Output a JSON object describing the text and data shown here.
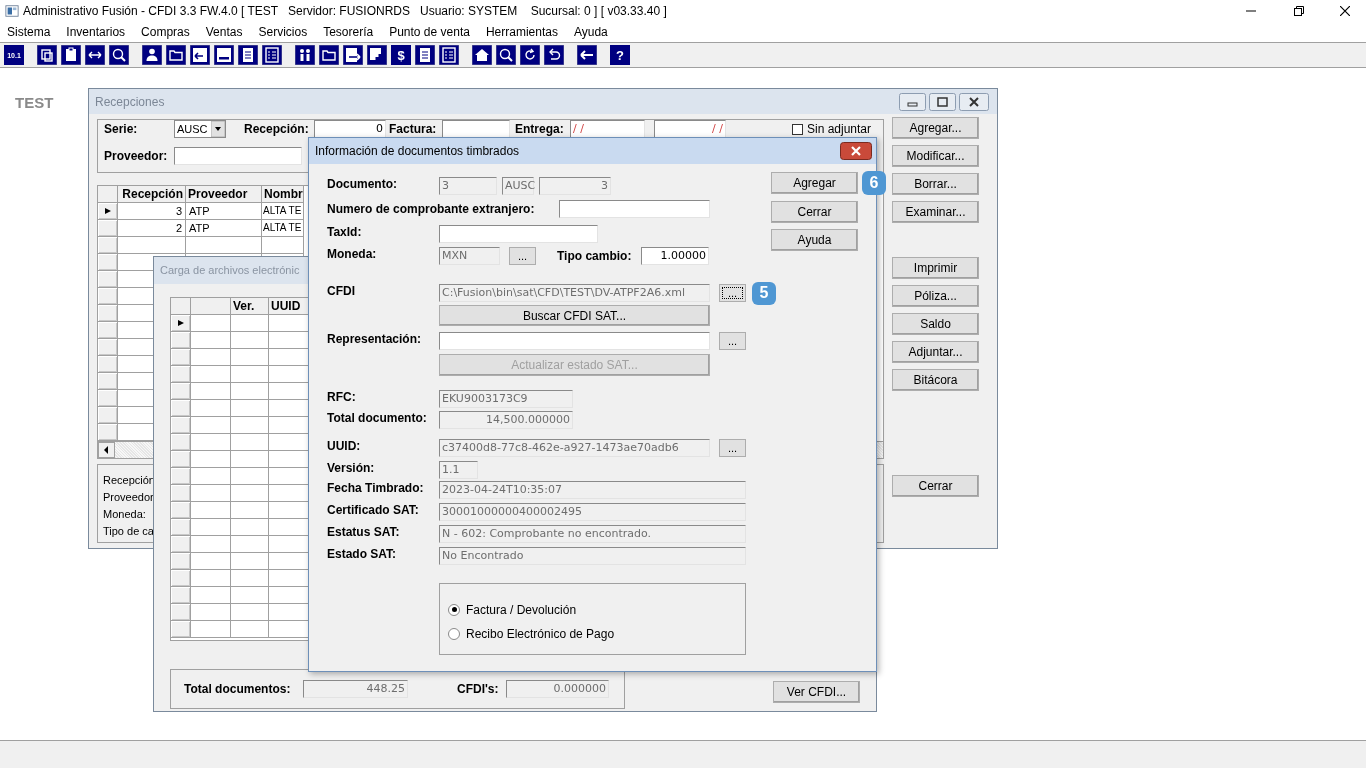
{
  "app": {
    "title": "Administrativo Fusión - CFDI 3.3 FW.4.0 [ TEST   Servidor: FUSIONRDS   Usuario: SYSTEM    Sucursal: 0 ] [ v03.33.40 ]"
  },
  "menu": [
    "Sistema",
    "Inventarios",
    "Compras",
    "Ventas",
    "Servicios",
    "Tesorería",
    "Punto de venta",
    "Herramientas",
    "Ayuda"
  ],
  "toolbar": {
    "version_glyph": "10.1",
    "dollar_glyph": "$",
    "help_glyph": "?"
  },
  "desktop_label": "TEST",
  "recepciones": {
    "title": "Recepciones",
    "serie": {
      "label": "Serie:",
      "value": "AUSC"
    },
    "recepcion": {
      "label": "Recepción:",
      "value": "0"
    },
    "factura": {
      "label": "Factura:"
    },
    "entrega": {
      "label": "Entrega:",
      "from": "/ /",
      "to": "/ /"
    },
    "sin_adjuntar": {
      "label": "Sin adjuntar",
      "checked": false
    },
    "proveedor": {
      "label": "Proveedor:"
    },
    "table": {
      "columns": [
        "Recepción",
        "Proveedor",
        "Nombr"
      ],
      "rows": [
        {
          "cells": [
            "3",
            "ATP",
            "ALTA TE"
          ],
          "selected": true
        },
        {
          "cells": [
            "2",
            "ATP",
            "ALTA TE"
          ],
          "selected": false
        }
      ]
    },
    "info_labels": [
      "Recepción",
      "Proveedor",
      "Moneda:",
      "Tipo de ca"
    ],
    "button_groups": [
      [
        "Agregar...",
        "Modificar...",
        "Borrar...",
        "Examinar..."
      ],
      [
        "Imprimir",
        "Póliza...",
        "Saldo",
        "Adjuntar...",
        "Bitácora"
      ],
      [
        "Cerrar"
      ]
    ]
  },
  "carga": {
    "title": "Carga de archivos electrónic",
    "columns": [
      "Ver.",
      "UUID"
    ],
    "total_documentos": {
      "label": "Total documentos:",
      "value": "448.25"
    },
    "cfdis": {
      "label": "CFDI's:",
      "value": "0.000000"
    },
    "ver_button": "Ver CFDI..."
  },
  "dialog": {
    "title": "Información de documentos timbrados",
    "documento": {
      "label": "Documento:",
      "fields": [
        {
          "value": "3",
          "disabled": true
        },
        {
          "value": "AUSC",
          "disabled": true
        },
        {
          "value": "3",
          "disabled": true
        }
      ]
    },
    "numero_extranjero": {
      "label": "Numero de comprobante extranjero:",
      "field": {
        "disabled": false
      }
    },
    "taxid": {
      "label": "TaxId:",
      "field": {
        "disabled": false
      }
    },
    "moneda": {
      "label": "Moneda:",
      "field": {
        "value": "MXN",
        "disabled": true
      },
      "browse": "..."
    },
    "tipo_cambio": {
      "label": "Tipo cambio:",
      "field": {
        "value": "1.00000",
        "disabled": false
      }
    },
    "cfdi": {
      "label": "CFDI",
      "field": {
        "value": "C:\\Fusion\\bin\\sat\\CFD\\TEST\\DV-ATPF2A6.xml",
        "disabled": true
      },
      "browse": "...",
      "browse_focused": true,
      "callout": "5"
    },
    "buscar_button": {
      "label": "Buscar CFDI SAT...",
      "disabled": false
    },
    "representacion": {
      "label": "Representación:",
      "field": {
        "disabled": false
      },
      "browse": "..."
    },
    "actualizar_button": {
      "label": "Actualizar estado SAT...",
      "disabled": true
    },
    "rfc": {
      "label": "RFC:",
      "field": {
        "value": "EKU9003173C9",
        "disabled": true
      }
    },
    "total_documento": {
      "label": "Total documento:",
      "field": {
        "value": "14,500.000000",
        "disabled": true
      }
    },
    "uuid": {
      "label": "UUID:",
      "field": {
        "value": "c37400d8-77c8-462e-a927-1473ae70adb6",
        "disabled": true
      },
      "browse": "..."
    },
    "version": {
      "label": "Versión:",
      "field": {
        "value": "1.1",
        "disabled": true
      }
    },
    "fecha": {
      "label": "Fecha Timbrado:",
      "field": {
        "value": "2023-04-24T10:35:07",
        "disabled": true
      }
    },
    "certificado": {
      "label": "Certificado SAT:",
      "field": {
        "value": "30001000000400002495",
        "disabled": true
      }
    },
    "estatus": {
      "label": "Estatus SAT:",
      "field": {
        "value": "N - 602: Comprobante no encontrado.",
        "disabled": true
      }
    },
    "estado": {
      "label": "Estado SAT:",
      "field": {
        "value": "No Encontrado",
        "disabled": true
      }
    },
    "tipo": [
      {
        "label": "Factura / Devolución",
        "selected": true
      },
      {
        "label": "Recibo Electrónico de Pago",
        "selected": false
      }
    ],
    "buttons": [
      {
        "label": "Agregar",
        "callout": "6"
      },
      {
        "label": "Cerrar"
      },
      {
        "label": "Ayuda"
      }
    ]
  }
}
